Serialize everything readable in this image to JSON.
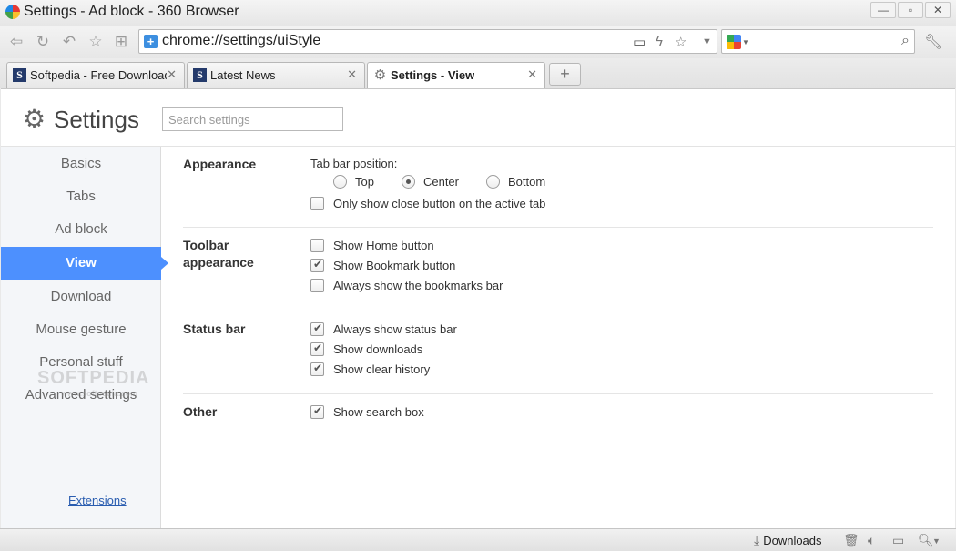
{
  "window": {
    "title": "Settings - Ad block - 360 Browser"
  },
  "toolbar": {
    "url": "chrome://settings/uiStyle"
  },
  "tabs": [
    {
      "label": "Softpedia - Free Download"
    },
    {
      "label": "Latest News"
    },
    {
      "label": "Settings - View"
    }
  ],
  "header": {
    "title": "Settings",
    "search_placeholder": "Search settings"
  },
  "sidebar": {
    "items": [
      {
        "label": "Basics"
      },
      {
        "label": "Tabs"
      },
      {
        "label": "Ad block"
      },
      {
        "label": "View"
      },
      {
        "label": "Download"
      },
      {
        "label": "Mouse gesture"
      },
      {
        "label": "Personal stuff"
      },
      {
        "label": "Advanced settings"
      }
    ],
    "active": "View",
    "extensions_link": "Extensions"
  },
  "sections": {
    "appearance": {
      "title": "Appearance",
      "tab_bar_label": "Tab bar position:",
      "radio_options": [
        "Top",
        "Center",
        "Bottom"
      ],
      "selected": "Center",
      "close_button_option": "Only show close button on the active tab"
    },
    "toolbar_appearance": {
      "title": "Toolbar appearance",
      "options": [
        "Show Home button",
        "Show Bookmark button",
        "Always show the bookmarks bar"
      ]
    },
    "status_bar": {
      "title": "Status bar",
      "options": [
        "Always show status bar",
        "Show downloads",
        "Show clear history"
      ]
    },
    "other": {
      "title": "Other",
      "options": [
        "Show search box"
      ]
    }
  },
  "watermark": {
    "text": "SOFTPEDIA",
    "sub": "www.softpedia.com"
  },
  "statusbar": {
    "downloads_label": "Downloads"
  },
  "colors": {
    "accent": "#4d90fe",
    "link": "#2a5db0"
  }
}
